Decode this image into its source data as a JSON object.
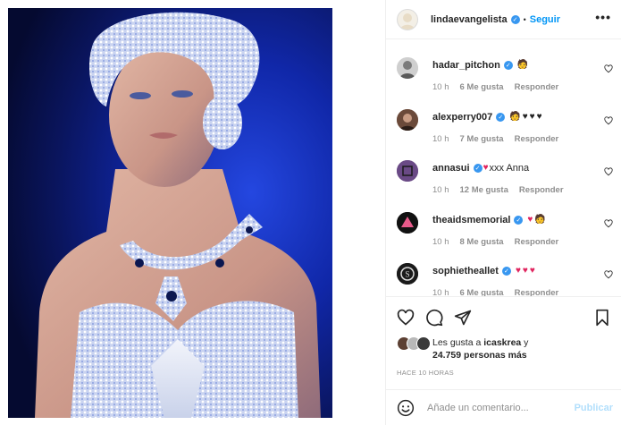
{
  "post": {
    "username": "lindaevangelista",
    "follow_label": "Seguir",
    "more_label": "•••",
    "separator": "•"
  },
  "comments": [
    {
      "user": "hadar_pitchon",
      "text": "",
      "emojis": [
        "person-emoji"
      ],
      "time": "10 h",
      "likes": "6 Me gusta",
      "reply": "Responder"
    },
    {
      "user": "alexperry007",
      "text": "",
      "emojis": [
        "person-emoji",
        "black-heart",
        "black-heart",
        "black-heart"
      ],
      "time": "10 h",
      "likes": "7 Me gusta",
      "reply": "Responder"
    },
    {
      "user": "annasui",
      "text": "xxx Anna",
      "emojis": [
        "heart-smiley-emoji"
      ],
      "time": "10 h",
      "likes": "12 Me gusta",
      "reply": "Responder"
    },
    {
      "user": "theaidsmemorial",
      "text": "",
      "emojis": [
        "red-heart",
        "person-emoji"
      ],
      "time": "10 h",
      "likes": "8 Me gusta",
      "reply": "Responder"
    },
    {
      "user": "sophietheallet",
      "text": "",
      "emojis": [
        "red-heart",
        "red-heart",
        "red-heart"
      ],
      "time": "10 h",
      "likes": "6 Me gusta",
      "reply": "Responder"
    }
  ],
  "likes": {
    "prefix": "Les gusta a ",
    "user": "icaskrea",
    "mid": " y",
    "others": "24.759 personas más"
  },
  "time_ago": "HACE 10 HORAS",
  "add_comment": {
    "placeholder": "Añade un comentario...",
    "publish": "Publicar"
  },
  "colors": {
    "accent": "#0095f6",
    "verified": "#3897f0",
    "publish_disabled": "#b2dffc",
    "muted": "#8e8e8e",
    "heart_red": "#e0245e"
  }
}
